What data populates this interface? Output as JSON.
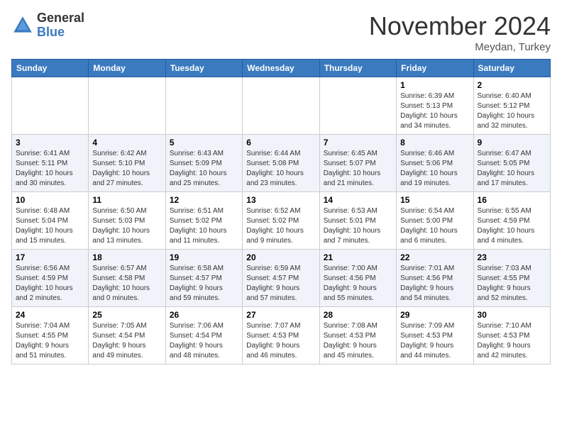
{
  "header": {
    "logo_general": "General",
    "logo_blue": "Blue",
    "month_title": "November 2024",
    "location": "Meydan, Turkey"
  },
  "weekdays": [
    "Sunday",
    "Monday",
    "Tuesday",
    "Wednesday",
    "Thursday",
    "Friday",
    "Saturday"
  ],
  "weeks": [
    [
      {
        "day": "",
        "info": ""
      },
      {
        "day": "",
        "info": ""
      },
      {
        "day": "",
        "info": ""
      },
      {
        "day": "",
        "info": ""
      },
      {
        "day": "",
        "info": ""
      },
      {
        "day": "1",
        "info": "Sunrise: 6:39 AM\nSunset: 5:13 PM\nDaylight: 10 hours\nand 34 minutes."
      },
      {
        "day": "2",
        "info": "Sunrise: 6:40 AM\nSunset: 5:12 PM\nDaylight: 10 hours\nand 32 minutes."
      }
    ],
    [
      {
        "day": "3",
        "info": "Sunrise: 6:41 AM\nSunset: 5:11 PM\nDaylight: 10 hours\nand 30 minutes."
      },
      {
        "day": "4",
        "info": "Sunrise: 6:42 AM\nSunset: 5:10 PM\nDaylight: 10 hours\nand 27 minutes."
      },
      {
        "day": "5",
        "info": "Sunrise: 6:43 AM\nSunset: 5:09 PM\nDaylight: 10 hours\nand 25 minutes."
      },
      {
        "day": "6",
        "info": "Sunrise: 6:44 AM\nSunset: 5:08 PM\nDaylight: 10 hours\nand 23 minutes."
      },
      {
        "day": "7",
        "info": "Sunrise: 6:45 AM\nSunset: 5:07 PM\nDaylight: 10 hours\nand 21 minutes."
      },
      {
        "day": "8",
        "info": "Sunrise: 6:46 AM\nSunset: 5:06 PM\nDaylight: 10 hours\nand 19 minutes."
      },
      {
        "day": "9",
        "info": "Sunrise: 6:47 AM\nSunset: 5:05 PM\nDaylight: 10 hours\nand 17 minutes."
      }
    ],
    [
      {
        "day": "10",
        "info": "Sunrise: 6:48 AM\nSunset: 5:04 PM\nDaylight: 10 hours\nand 15 minutes."
      },
      {
        "day": "11",
        "info": "Sunrise: 6:50 AM\nSunset: 5:03 PM\nDaylight: 10 hours\nand 13 minutes."
      },
      {
        "day": "12",
        "info": "Sunrise: 6:51 AM\nSunset: 5:02 PM\nDaylight: 10 hours\nand 11 minutes."
      },
      {
        "day": "13",
        "info": "Sunrise: 6:52 AM\nSunset: 5:02 PM\nDaylight: 10 hours\nand 9 minutes."
      },
      {
        "day": "14",
        "info": "Sunrise: 6:53 AM\nSunset: 5:01 PM\nDaylight: 10 hours\nand 7 minutes."
      },
      {
        "day": "15",
        "info": "Sunrise: 6:54 AM\nSunset: 5:00 PM\nDaylight: 10 hours\nand 6 minutes."
      },
      {
        "day": "16",
        "info": "Sunrise: 6:55 AM\nSunset: 4:59 PM\nDaylight: 10 hours\nand 4 minutes."
      }
    ],
    [
      {
        "day": "17",
        "info": "Sunrise: 6:56 AM\nSunset: 4:59 PM\nDaylight: 10 hours\nand 2 minutes."
      },
      {
        "day": "18",
        "info": "Sunrise: 6:57 AM\nSunset: 4:58 PM\nDaylight: 10 hours\nand 0 minutes."
      },
      {
        "day": "19",
        "info": "Sunrise: 6:58 AM\nSunset: 4:57 PM\nDaylight: 9 hours\nand 59 minutes."
      },
      {
        "day": "20",
        "info": "Sunrise: 6:59 AM\nSunset: 4:57 PM\nDaylight: 9 hours\nand 57 minutes."
      },
      {
        "day": "21",
        "info": "Sunrise: 7:00 AM\nSunset: 4:56 PM\nDaylight: 9 hours\nand 55 minutes."
      },
      {
        "day": "22",
        "info": "Sunrise: 7:01 AM\nSunset: 4:56 PM\nDaylight: 9 hours\nand 54 minutes."
      },
      {
        "day": "23",
        "info": "Sunrise: 7:03 AM\nSunset: 4:55 PM\nDaylight: 9 hours\nand 52 minutes."
      }
    ],
    [
      {
        "day": "24",
        "info": "Sunrise: 7:04 AM\nSunset: 4:55 PM\nDaylight: 9 hours\nand 51 minutes."
      },
      {
        "day": "25",
        "info": "Sunrise: 7:05 AM\nSunset: 4:54 PM\nDaylight: 9 hours\nand 49 minutes."
      },
      {
        "day": "26",
        "info": "Sunrise: 7:06 AM\nSunset: 4:54 PM\nDaylight: 9 hours\nand 48 minutes."
      },
      {
        "day": "27",
        "info": "Sunrise: 7:07 AM\nSunset: 4:53 PM\nDaylight: 9 hours\nand 46 minutes."
      },
      {
        "day": "28",
        "info": "Sunrise: 7:08 AM\nSunset: 4:53 PM\nDaylight: 9 hours\nand 45 minutes."
      },
      {
        "day": "29",
        "info": "Sunrise: 7:09 AM\nSunset: 4:53 PM\nDaylight: 9 hours\nand 44 minutes."
      },
      {
        "day": "30",
        "info": "Sunrise: 7:10 AM\nSunset: 4:53 PM\nDaylight: 9 hours\nand 42 minutes."
      }
    ]
  ]
}
